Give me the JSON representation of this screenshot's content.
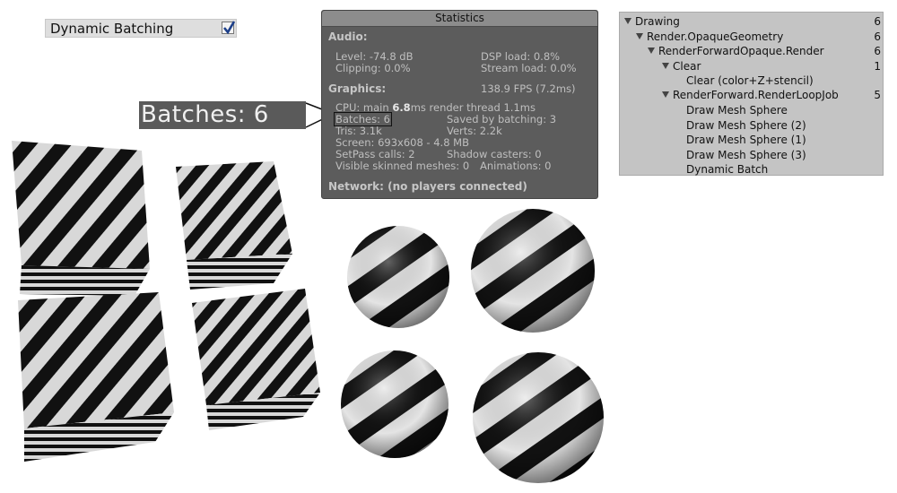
{
  "toggle": {
    "label": "Dynamic Batching",
    "checked": true
  },
  "callout": {
    "text": "Batches: 6"
  },
  "stats": {
    "title": "Statistics",
    "audio_heading": "Audio:",
    "level": "Level: -74.8 dB",
    "dsp_load": "DSP load: 0.8%",
    "clipping": "Clipping: 0.0%",
    "stream_load": "Stream load: 0.0%",
    "graphics_heading": "Graphics:",
    "fps": "138.9 FPS (7.2ms)",
    "cpu_prefix": "CPU: main ",
    "cpu_main": "6.8",
    "cpu_suffix": "ms  render thread 1.1ms",
    "batches": "Batches: 6",
    "saved_by_batching": "Saved by batching: 3",
    "tris": "Tris: 3.1k",
    "verts": "Verts: 2.2k",
    "screen": "Screen: 693x608 - 4.8 MB",
    "setpass": "SetPass calls: 2",
    "shadow_casters": "Shadow casters: 0",
    "skinned": "Visible skinned meshes: 0",
    "animations": "Animations: 0",
    "network": "Network: (no players connected)"
  },
  "tree": {
    "rows": [
      {
        "label": "Drawing",
        "count": "6",
        "arrow": true
      },
      {
        "label": "Render.OpaqueGeometry",
        "count": "6",
        "arrow": true
      },
      {
        "label": "RenderForwardOpaque.Render",
        "count": "6",
        "arrow": true
      },
      {
        "label": "Clear",
        "count": "1",
        "arrow": true
      },
      {
        "label": "Clear (color+Z+stencil)",
        "count": "",
        "arrow": false
      },
      {
        "label": "RenderForward.RenderLoopJob",
        "count": "5",
        "arrow": true
      },
      {
        "label": "Draw Mesh Sphere",
        "count": "",
        "arrow": false
      },
      {
        "label": "Draw Mesh Sphere (2)",
        "count": "",
        "arrow": false
      },
      {
        "label": "Draw Mesh Sphere (1)",
        "count": "",
        "arrow": false
      },
      {
        "label": "Draw Mesh Sphere (3)",
        "count": "",
        "arrow": false
      },
      {
        "label": "Dynamic Batch",
        "count": "",
        "arrow": false
      }
    ]
  },
  "colors": {
    "stripe_dark": "#111111",
    "stripe_light": "#d8d8d8",
    "panel": "#5c5c5c",
    "tree_bg": "#c4c4c4"
  },
  "scene": {
    "cubes": 4,
    "spheres": 4
  }
}
